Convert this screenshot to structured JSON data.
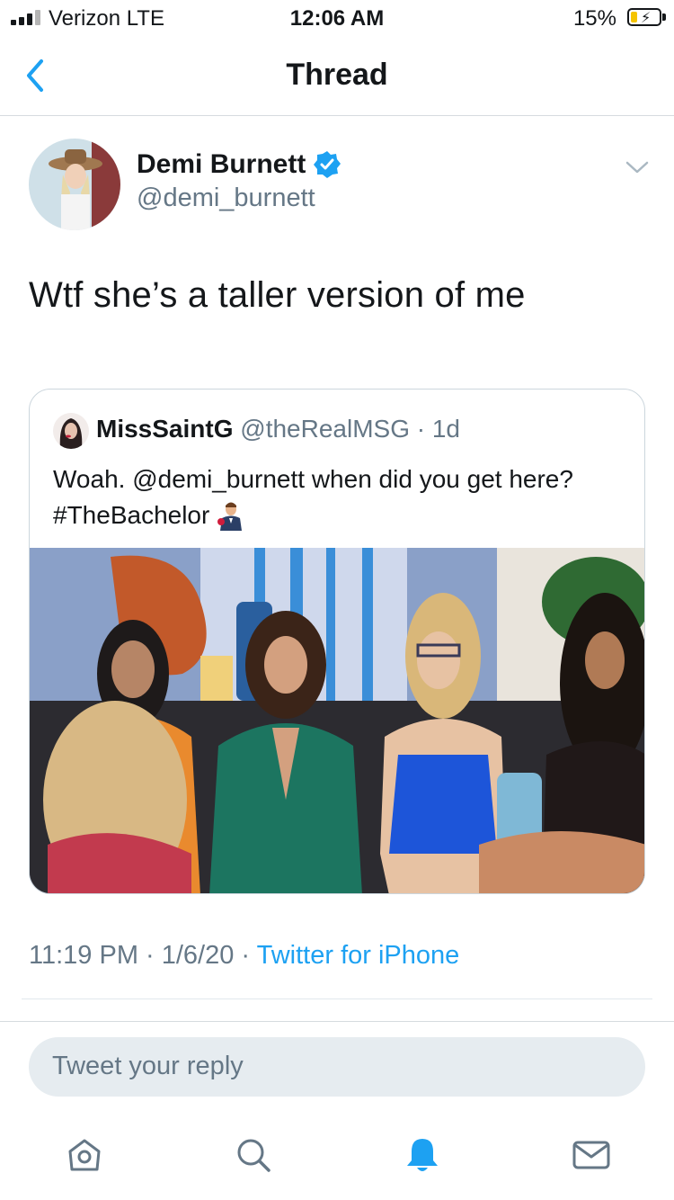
{
  "status_bar": {
    "carrier": "Verizon  LTE",
    "time": "12:06 AM",
    "battery": "15%"
  },
  "nav": {
    "title": "Thread"
  },
  "tweet": {
    "author_name": "Demi Burnett",
    "author_handle": "@demi_burnett",
    "verified": true,
    "text": "Wtf she’s a taller version of me",
    "quoted": {
      "name": "MissSaintG",
      "handle_time": "@theRealMSG · 1d",
      "text_line1": "Woah. @demi_burnett when did you get here?",
      "text_line2": "#TheBachelor"
    },
    "timestamp": "11:19 PM · 1/6/20 · ",
    "source": "Twitter for iPhone"
  },
  "reply": {
    "placeholder": "Tweet your reply"
  },
  "tabs": [
    "home-icon",
    "search-icon",
    "notifications-icon",
    "messages-icon"
  ],
  "colors": {
    "accent": "#1da1f2",
    "secondary_text": "#657786",
    "reply_bg": "#e6ecf0"
  }
}
